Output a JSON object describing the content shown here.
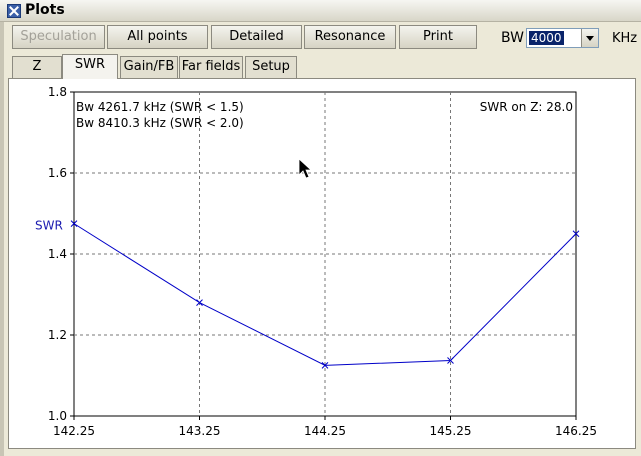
{
  "window": {
    "title": "Plots"
  },
  "toolbar": {
    "buttons": [
      {
        "label": "Speculation",
        "enabled": false
      },
      {
        "label": "All points",
        "enabled": true
      },
      {
        "label": "Detailed",
        "enabled": true
      },
      {
        "label": "Resonance",
        "enabled": true
      },
      {
        "label": "Print",
        "enabled": true
      }
    ],
    "bw_label": "BW",
    "bw_value": "4000",
    "bw_unit": "KHz"
  },
  "tabs": [
    {
      "label": "Z",
      "active": false
    },
    {
      "label": "SWR",
      "active": true
    },
    {
      "label": "Gain/FB",
      "active": false
    },
    {
      "label": "Far fields",
      "active": false
    },
    {
      "label": "Setup",
      "active": false
    }
  ],
  "colors": {
    "series": "#0000c8",
    "ylabel": "#1a1ab0"
  },
  "chart_data": {
    "type": "line",
    "xlabel": "",
    "ylabel": "SWR",
    "xlim": [
      142.25,
      146.25
    ],
    "ylim": [
      1.0,
      1.8
    ],
    "x_ticks": [
      "142.25",
      "143.25",
      "144.25",
      "145.25",
      "146.25"
    ],
    "y_ticks": [
      "1.0",
      "1.2",
      "1.4",
      "1.6",
      "1.8"
    ],
    "grid": true,
    "annotations": [
      "Bw 4261.7 kHz (SWR < 1.5)",
      "Bw 8410.3 kHz (SWR < 2.0)",
      "SWR on Z: 28.0"
    ],
    "series": [
      {
        "x": [
          142.25,
          143.25,
          144.25,
          145.25,
          146.25
        ],
        "y": [
          1.475,
          1.28,
          1.125,
          1.137,
          1.45
        ]
      }
    ]
  }
}
